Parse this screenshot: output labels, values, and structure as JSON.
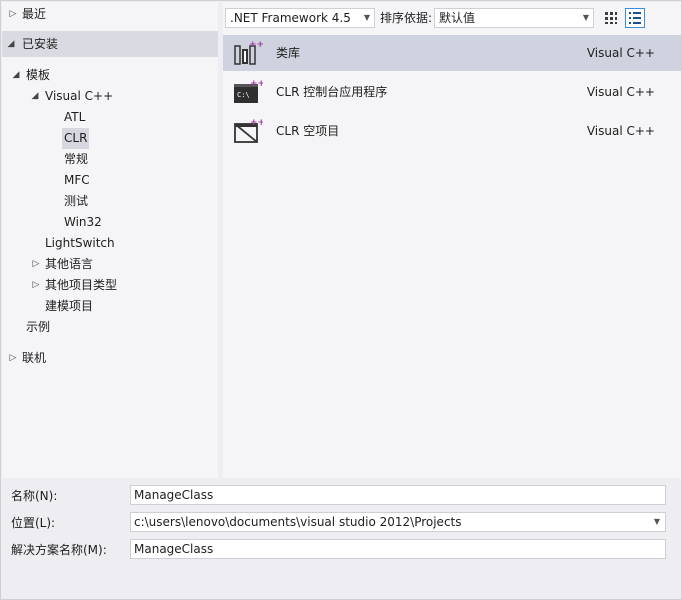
{
  "tree": {
    "recent": "最近",
    "installed": "已安装",
    "templates": "模板",
    "visual_cpp": "Visual C++",
    "atl": "ATL",
    "clr": "CLR",
    "general": "常规",
    "mfc": "MFC",
    "test": "测试",
    "win32": "Win32",
    "lightswitch": "LightSwitch",
    "other_languages": "其他语言",
    "other_project_types": "其他项目类型",
    "modeling_projects": "建模项目",
    "samples": "示例",
    "online": "联机"
  },
  "toolbar": {
    "framework": ".NET Framework 4.5",
    "sort_label": "排序依据:",
    "sort_value": "默认值",
    "small_icons_icon": "small-icons-view-icon",
    "details_icon": "details-view-icon"
  },
  "templates": [
    {
      "name": "类库",
      "lang": "Visual C++",
      "icon": "class-library-icon",
      "selected": true
    },
    {
      "name": "CLR 控制台应用程序",
      "lang": "Visual C++",
      "icon": "clr-console-icon",
      "selected": false
    },
    {
      "name": "CLR 空项目",
      "lang": "Visual C++",
      "icon": "clr-empty-project-icon",
      "selected": false
    }
  ],
  "form": {
    "name_label": "名称(N):",
    "name_value": "ManageClass",
    "location_label": "位置(L):",
    "location_value": "c:\\users\\lenovo\\documents\\visual studio 2012\\Projects",
    "solution_label": "解决方案名称(M):",
    "solution_value": "ManageClass"
  },
  "colors": {
    "selection": "#cfd3df",
    "accent": "#3b8edd",
    "icon_purple": "#a53ba3"
  }
}
